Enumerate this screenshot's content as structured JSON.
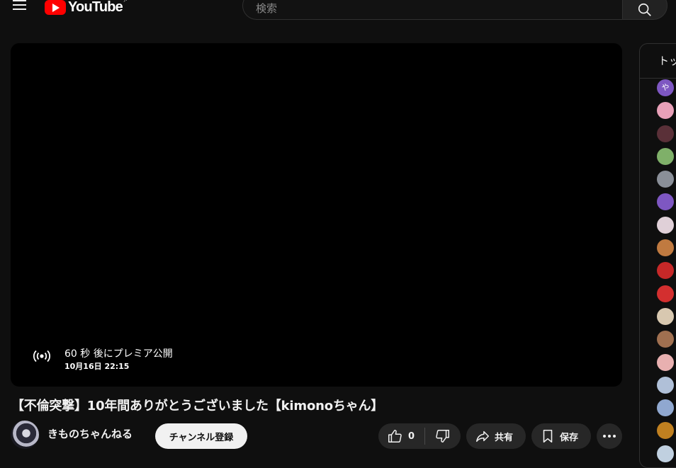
{
  "header": {
    "logo_text": "YouTube",
    "region_code": "JP",
    "search_placeholder": "検索"
  },
  "player": {
    "premiere_text": "60 秒 後にプレミア公開",
    "premiere_datetime": "10月16日 22:15"
  },
  "video": {
    "title": "【不倫突撃】10年間ありがとうございました【kimonoちゃん】",
    "channel_name": "きものちゃんねる",
    "subscribe_label": "チャンネル登録",
    "like_count": "0",
    "share_label": "共有",
    "save_label": "保存"
  },
  "chat": {
    "header_text": "トップ チャット",
    "avatar_colors": [
      "#7e57c2",
      "#e8a0b8",
      "#5a3038",
      "#7fb069",
      "#8a8f98",
      "#7e57c2",
      "#e0d0d8",
      "#c07a40",
      "#c62828",
      "#d32f2f",
      "#d8c8b0",
      "#a07050",
      "#e8b0b0",
      "#b0c0d8",
      "#90a8d0",
      "#c08020",
      "#c0d0e0"
    ],
    "avatar_first_letter": "や"
  }
}
